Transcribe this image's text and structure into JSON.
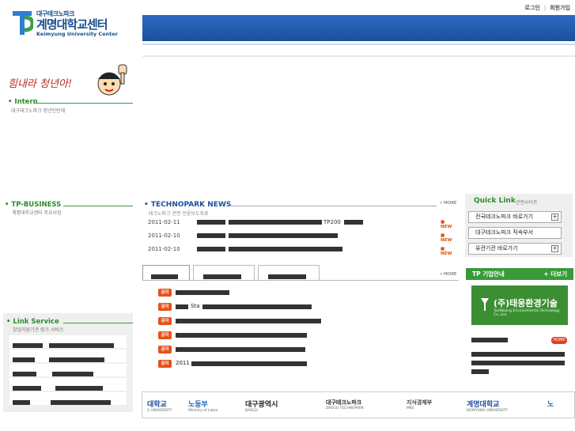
{
  "top_links": {
    "login": "로그인",
    "separator": "|",
    "join": "회원가입"
  },
  "logo": {
    "line1": "대구테크노파크",
    "line2": "계명대학교센터",
    "line3": "Keimyung University Center"
  },
  "left": {
    "slogan": "힘내라 청년아!",
    "intern_title": "Intern",
    "intern_sub": "대구테크노파크 청년인턴제",
    "tpbiz_title": "TP-BUSINESS",
    "tpbiz_sub": "계명대학교센터 주요사업",
    "link_service_title": "Link Service",
    "link_service_sub": "창업지원기관 링크 서비스"
  },
  "news": {
    "title": "TECHNOPARK NEWS",
    "subtitle": "테크노파크 관련 언론보도자료",
    "more": "MORE",
    "items": [
      {
        "date": "2011-02-11",
        "text": "TP200",
        "badge": "NEW"
      },
      {
        "date": "2011-02-10",
        "text": "",
        "badge": "NEW"
      },
      {
        "date": "2011-02-10",
        "text": "",
        "badge": "NEW"
      }
    ]
  },
  "notices": {
    "more": "MORE",
    "badge": "공지",
    "items": [
      {
        "text": ""
      },
      {
        "text": "Sta"
      },
      {
        "text": ""
      },
      {
        "text": ""
      },
      {
        "text": ""
      },
      {
        "text": "2011"
      }
    ]
  },
  "quick_link": {
    "title": "Quick Link",
    "subtitle": "관련사이트",
    "buttons": [
      {
        "label": "전국테크노파크 바로가기"
      },
      {
        "label": "대구테크노파크 직속부서"
      },
      {
        "label": "유관기관 바로가기"
      }
    ]
  },
  "tp_company": {
    "title": "TP 기업안내",
    "more": "+ 더보기",
    "banner_text": "(주)태웅환경기술",
    "banner_sub": "TaeWoong Environmental Technology Co.,Ltd.",
    "home_badge": "HOME"
  },
  "footer_logos": [
    {
      "name": "대학교",
      "sub": "G UNIVERSITY"
    },
    {
      "name": "노동부",
      "sub": "Ministry of Labor"
    },
    {
      "name": "대구광역시",
      "sub": "DAEGU"
    },
    {
      "name": "대구테크노파크",
      "sub": "DAEGU TECHNOPARK"
    },
    {
      "name": "지식경제부",
      "sub": "MKE"
    },
    {
      "name": "계명대학교",
      "sub": "KEIMYUNG UNIVERSITY"
    },
    {
      "name": "노",
      "sub": ""
    }
  ],
  "colors": {
    "brand_blue": "#1d4f9e",
    "green": "#3a9a3a",
    "new_orange": "#e05010"
  }
}
